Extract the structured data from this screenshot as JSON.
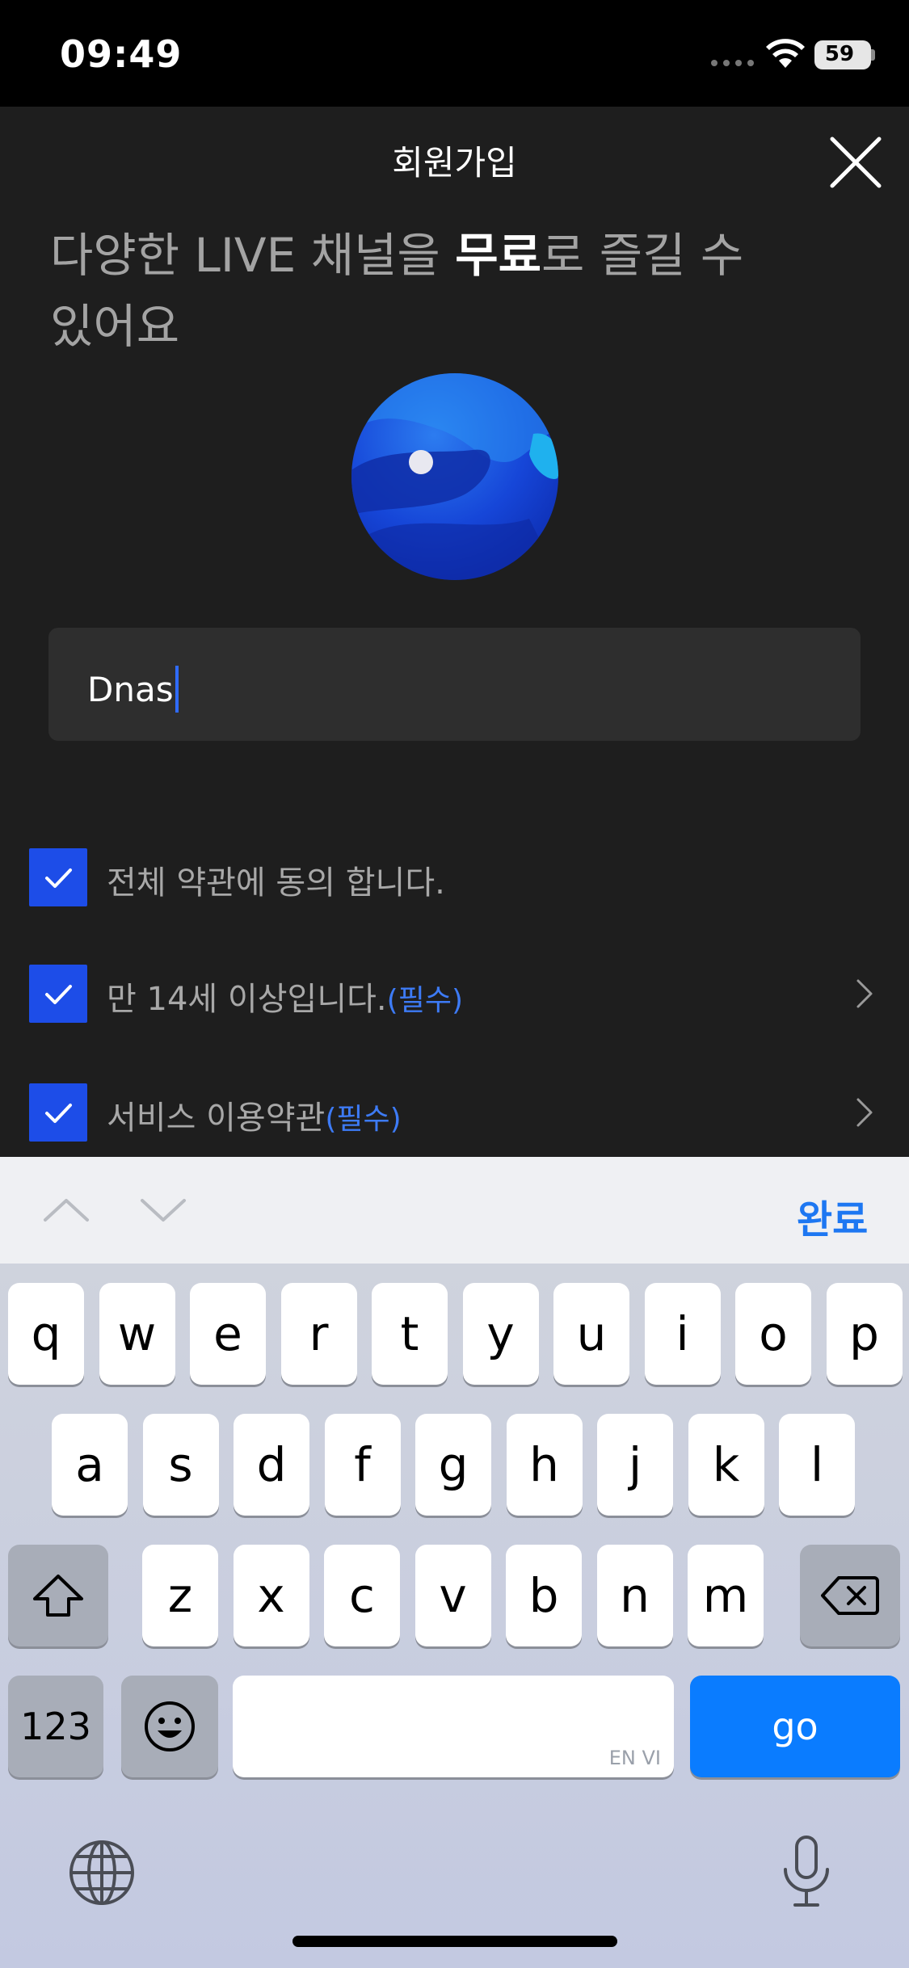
{
  "status": {
    "time": "09:49",
    "battery": "59"
  },
  "header": {
    "title": "회원가입"
  },
  "headline": {
    "part1": "다양한 LIVE 채널을 ",
    "bold": "무료",
    "part2": "로 즐길 수 있어요"
  },
  "input": {
    "value": "Dnas"
  },
  "agreements": [
    {
      "label": "전체 약관에 동의 합니다.",
      "required": "",
      "checked": true
    },
    {
      "label": "만 14세 이상입니다.",
      "required": "(필수)",
      "checked": true
    },
    {
      "label": "서비스 이용약관",
      "required": "(필수)",
      "checked": true
    }
  ],
  "keyboard": {
    "done_label": "완료",
    "row1": [
      "q",
      "w",
      "e",
      "r",
      "t",
      "y",
      "u",
      "i",
      "o",
      "p"
    ],
    "row2": [
      "a",
      "s",
      "d",
      "f",
      "g",
      "h",
      "j",
      "k",
      "l"
    ],
    "row3": [
      "z",
      "x",
      "c",
      "v",
      "b",
      "n",
      "m"
    ],
    "numbers_label": "123",
    "space_hint": "EN VI",
    "go_label": "go"
  },
  "colors": {
    "accent": "#1d4de8",
    "required": "#3d7bf6",
    "go": "#0a7cff"
  }
}
